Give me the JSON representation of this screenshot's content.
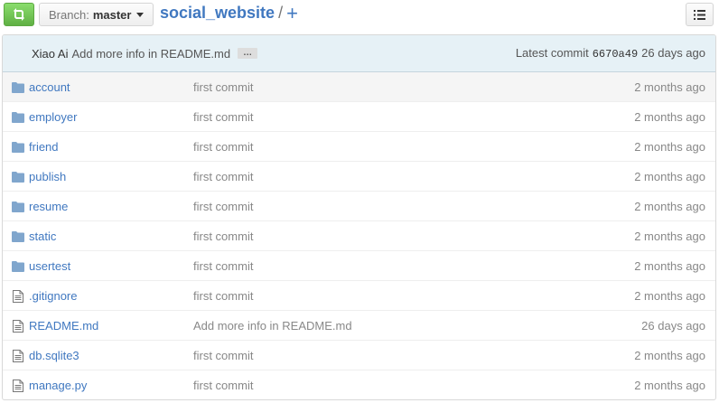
{
  "header": {
    "branch_prefix": "Branch:",
    "branch_name": "master",
    "repo_name": "social_website",
    "separator": "/",
    "add_label": "+"
  },
  "commit": {
    "author": "Xiao Ai",
    "message": "Add more info in README.md",
    "ellipsis": "…",
    "latest_label": "Latest commit",
    "sha": "6670a49",
    "age": "26 days ago"
  },
  "files": [
    {
      "type": "dir",
      "name": "account",
      "message": "first commit",
      "age": "2 months ago"
    },
    {
      "type": "dir",
      "name": "employer",
      "message": "first commit",
      "age": "2 months ago"
    },
    {
      "type": "dir",
      "name": "friend",
      "message": "first commit",
      "age": "2 months ago"
    },
    {
      "type": "dir",
      "name": "publish",
      "message": "first commit",
      "age": "2 months ago"
    },
    {
      "type": "dir",
      "name": "resume",
      "message": "first commit",
      "age": "2 months ago"
    },
    {
      "type": "dir",
      "name": "static",
      "message": "first commit",
      "age": "2 months ago"
    },
    {
      "type": "dir",
      "name": "usertest",
      "message": "first commit",
      "age": "2 months ago"
    },
    {
      "type": "file",
      "name": ".gitignore",
      "message": "first commit",
      "age": "2 months ago"
    },
    {
      "type": "file",
      "name": "README.md",
      "message": "Add more info in README.md",
      "age": "26 days ago"
    },
    {
      "type": "file",
      "name": "db.sqlite3",
      "message": "first commit",
      "age": "2 months ago"
    },
    {
      "type": "file",
      "name": "manage.py",
      "message": "first commit",
      "age": "2 months ago"
    }
  ],
  "icons": {
    "compare": "compare-icon",
    "folder": "folder-icon",
    "file": "file-text-icon",
    "list": "list-icon"
  },
  "colors": {
    "link": "#4078c0",
    "compare_green": "#60b044",
    "commit_bar": "#e6f1f6",
    "folder": "#80a6cd"
  }
}
